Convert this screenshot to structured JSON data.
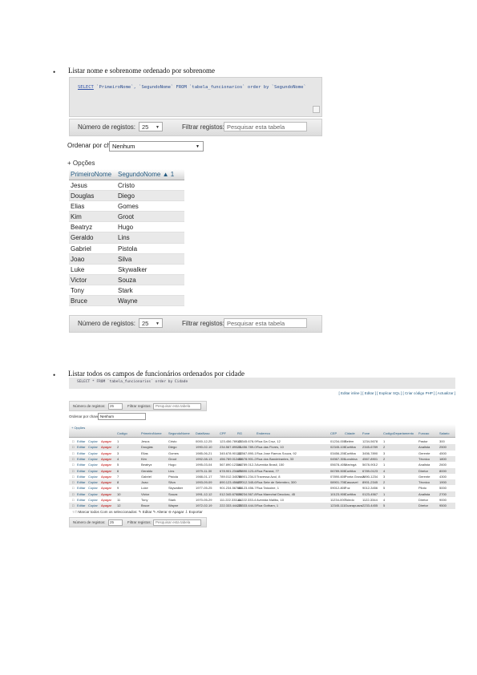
{
  "section1": {
    "bullet": "•",
    "heading": "Listar nome e sobrenome ordenado por sobrenome",
    "sql": {
      "keyword_select": "SELECT",
      "rest": " `PrimeiroNome`, `SegundoNome` FROM `tabela_funcionarios` order by `SegundoNome`"
    },
    "navbar_top": {
      "rows_label": "Número de registos:",
      "rows_value": "25",
      "filter_label": "Filtrar registos:",
      "filter_placeholder": "Pesquisar esta tabela"
    },
    "sort": {
      "label": "Ordenar por chave:",
      "value": "Nenhum"
    },
    "options_label": "+ Opções",
    "table": {
      "headers": [
        "PrimeiroNome",
        "SegundoNome ▲ 1"
      ],
      "rows": [
        [
          "Jesus",
          "Cristo"
        ],
        [
          "Douglas",
          "Diego"
        ],
        [
          "Elias",
          "Gomes"
        ],
        [
          "Kim",
          "Groot"
        ],
        [
          "Beatryz",
          "Hugo"
        ],
        [
          "Geraldo",
          "Lins"
        ],
        [
          "Gabriel",
          "Pistola"
        ],
        [
          "Joao",
          "Silva"
        ],
        [
          "Luke",
          "Skywalker"
        ],
        [
          "Victor",
          "Souza"
        ],
        [
          "Tony",
          "Stark"
        ],
        [
          "Bruce",
          "Wayne"
        ]
      ]
    },
    "navbar_bottom": {
      "rows_label": "Número de registos:",
      "rows_value": "25",
      "filter_label": "Filtrar registos:",
      "filter_placeholder": "Pesquisar esta tabela"
    }
  },
  "section2": {
    "bullet": "•",
    "heading": "Listar todos os campos de funcionários ordenados por cidade",
    "query_text": "SELECT * FROM `tabela_funcionarios` order by Cidade",
    "links": "[ Editar inline ] [ Editar ] [ Explicar SQL ] [ Criar código PHP ] [ Actualizar ]",
    "nav_rows_label": "Número de registos:",
    "nav_rows_value": "25",
    "nav_filter_label": "Filtrar registos:",
    "nav_filter_placeholder": "Pesquisar esta tabela",
    "sort_label": "Ordenar por chave:",
    "sort_value": "Nenhum",
    "options_label": "+ Opções",
    "headers": [
      "Codigo",
      "PrimeiroNome",
      "SegundoNome",
      "DataNasc",
      "CPF",
      "RG",
      "Endereco",
      "CEP",
      "Cidade",
      "Fone",
      "CodigoDepartamento",
      "Funcao",
      "Salario"
    ],
    "action_labels": {
      "edit": "Editar",
      "copy": "Copiar",
      "delete": "Apagar"
    },
    "rows": [
      [
        "1",
        "Jesus",
        "Cristo",
        "0000-12-25",
        "123.456.789-00",
        "12.345.678-9",
        "Rua Da Cruz, 12",
        "01234-000",
        "Belém",
        "1234-5678",
        "1",
        "Pastor",
        "300"
      ],
      [
        "2",
        "Douglas",
        "Diego",
        "1990-02-10",
        "234.567.890-11",
        "23.456.789-0",
        "Rua das Flores, 10",
        "02345-100",
        "Curitiba",
        "2345-6789",
        "2",
        "Analista",
        "2500"
      ],
      [
        "3",
        "Elias",
        "Gomes",
        "1985-06-21",
        "345.678.901-22",
        "34.567.890-1",
        "Rua Jose Ramos Souza, 92",
        "03456-200",
        "Curitiba",
        "3456-7890",
        "3",
        "Gerente",
        "4500"
      ],
      [
        "4",
        "Kim",
        "Groot",
        "1992-08-13",
        "456.789.012-33",
        "45.678.901-2",
        "Rua dos Bandeirantes, 33",
        "04567-300",
        "Londrina",
        "4567-8901",
        "2",
        "Técnico",
        "1800"
      ],
      [
        "5",
        "Beatryz",
        "Hugo",
        "1995-03-04",
        "567.890.123-44",
        "56.789.012-3",
        "Avenida Brasil, 150",
        "05678-400",
        "Maringá",
        "5678-9012",
        "1",
        "Analista",
        "2600"
      ],
      [
        "6",
        "Geraldo",
        "Lins",
        "1979-11-30",
        "678.901.234-55",
        "67.890.123-4",
        "Rua Paraná, 77",
        "06789-500",
        "Curitiba",
        "6789-0123",
        "4",
        "Diretor",
        "8000"
      ],
      [
        "7",
        "Gabriel",
        "Pistola",
        "1988-01-17",
        "789.012.345-66",
        "78.901.234-5",
        "Travessa Azul, 8",
        "07890-600",
        "Ponta Grossa",
        "7890-1234",
        "3",
        "Gerente",
        "4300"
      ],
      [
        "8",
        "Joao",
        "Silva",
        "1993-09-09",
        "890.123.456-77",
        "89.012.345-6",
        "Rua Sete de Setembro, 300",
        "08901-700",
        "Cascavel",
        "8901-2345",
        "2",
        "Técnico",
        "1900"
      ],
      [
        "9",
        "Luke",
        "Skywalker",
        "1977-05-25",
        "901.234.567-88",
        "90.123.456-7",
        "Rua Tatooine, 1",
        "09012-800",
        "Foz",
        "9012-3456",
        "5",
        "Piloto",
        "5000"
      ],
      [
        "10",
        "Victor",
        "Souza",
        "1991-12-12",
        "012.345.678-99",
        "01.234.567-8",
        "Rua Marechal Deodoro, 45",
        "10123-900",
        "Curitiba",
        "0123-4567",
        "1",
        "Analista",
        "2700"
      ],
      [
        "11",
        "Tony",
        "Stark",
        "1970-05-29",
        "111.222.333-44",
        "11.222.333-4",
        "Avenida Malibu, 10",
        "11234-000",
        "Toledo",
        "1122-3344",
        "4",
        "Diretor",
        "9000"
      ],
      [
        "12",
        "Bruce",
        "Wayne",
        "1972-02-19",
        "222.333.444-55",
        "22.333.444-5",
        "Rua Gotham, 1",
        "12345-111",
        "Guarapuava",
        "2233-4455",
        "5",
        "Diretor",
        "9500"
      ]
    ],
    "footer": "↑ □ Marcar todos   Com os seleccionados:  ✎ Editar   ✎ Alterar   ⊖ Apagar   ⇩ Exportar"
  }
}
